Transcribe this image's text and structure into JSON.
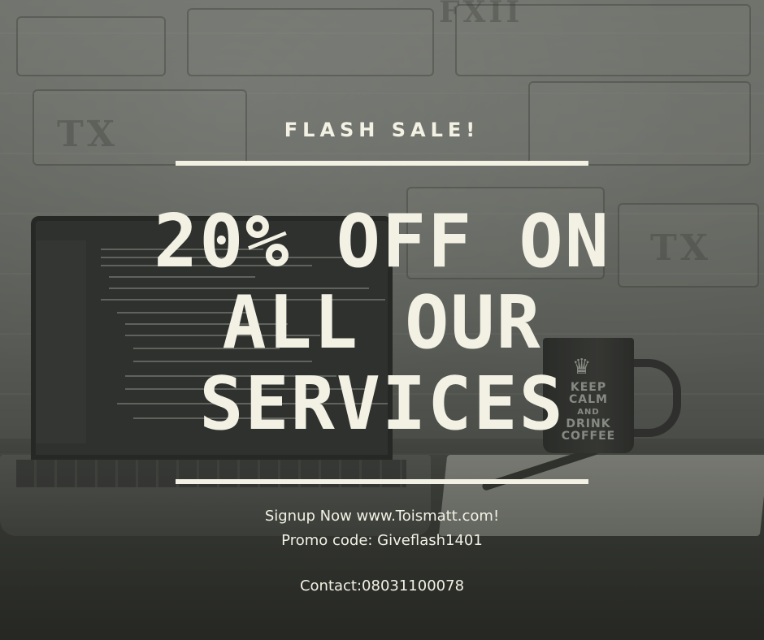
{
  "poster": {
    "eyebrow": "FLASH SALE!",
    "headline_lines": [
      "20% OFF ON",
      "ALL OUR",
      "SERVICES"
    ],
    "signup": "Signup Now www.Toismatt.com!",
    "promo": "Promo code: Giveflash1401",
    "contact": "Contact:08031100078"
  },
  "background_scene": {
    "mug_text": [
      "KEEP",
      "CALM",
      "AND",
      "DRINK",
      "COFFEE"
    ],
    "wall_letters": [
      "FXII",
      "TX",
      "TX"
    ]
  },
  "colors": {
    "text": "#f3f1e4",
    "overlay": "#373934"
  },
  "icons": {
    "mug_crown": "crown-icon"
  }
}
